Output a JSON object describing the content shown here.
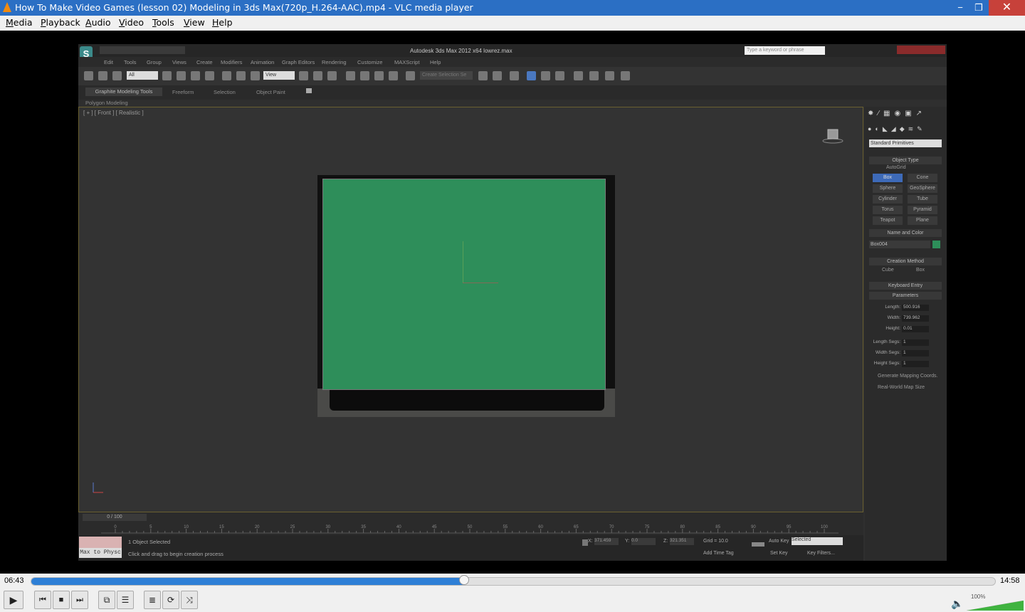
{
  "window": {
    "title": "How To Make Video Games (lesson 02) Modeling in 3ds Max(720p_H.264-AAC).mp4 - VLC media player",
    "min": "−",
    "max": "❐",
    "close": "✕"
  },
  "menubar": {
    "items": [
      {
        "u": "M",
        "rest": "edia"
      },
      {
        "u": "P",
        "rest": "layback"
      },
      {
        "u": "A",
        "rest": "udio"
      },
      {
        "u": "V",
        "rest": "ideo"
      },
      {
        "u": "T",
        "rest": "ools"
      },
      {
        "u": "V",
        "rest": "iew"
      },
      {
        "u": "H",
        "rest": "elp"
      }
    ]
  },
  "max": {
    "title": "Autodesk 3ds Max 2012 x64     lowrez.max",
    "search_placeholder": "Type a keyword or phrase",
    "logo": "S",
    "menu": [
      "Edit",
      "Tools",
      "Group",
      "Views",
      "Create",
      "Modifiers",
      "Animation",
      "Graph Editors",
      "Rendering",
      "Customize",
      "MAXScript",
      "Help"
    ],
    "toolbar": {
      "selection_filter": "All",
      "ref_coord": "View",
      "named_sel": "Create Selection Se"
    },
    "ribbon_tabs": [
      "Graphite Modeling Tools",
      "Freeform",
      "Selection",
      "Object Paint"
    ],
    "ribbon_sub": "Polygon Modeling",
    "viewport_label": "[ + ] [ Front ] [ Realistic ]",
    "time_slider": "0 / 100",
    "ruler_ticks": [
      "0",
      "5",
      "10",
      "15",
      "20",
      "25",
      "30",
      "35",
      "40",
      "45",
      "50",
      "55",
      "60",
      "65",
      "70",
      "75",
      "80",
      "85",
      "90",
      "95",
      "100"
    ],
    "status": {
      "macro": "Max to Physc",
      "selected": "1 Object Selected",
      "prompt": "Click and drag to begin creation process",
      "x_label": "X:",
      "x_val": "371.459",
      "y_label": "Y:",
      "y_val": "0.0",
      "z_label": "Z:",
      "z_val": "321.351",
      "grid": "Grid = 10.0",
      "auto_key": "Auto Key",
      "key_mode": "Selected",
      "set_key": "Set Key",
      "key_filters": "Key Filters...",
      "add_time_tag": "Add Time Tag",
      "frame": "0"
    },
    "panel": {
      "dropdown": "Standard Primitives",
      "object_type_title": "Object Type",
      "autogrid": "AutoGrid",
      "objects": [
        "Box",
        "Cone",
        "Sphere",
        "GeoSphere",
        "Cylinder",
        "Tube",
        "Torus",
        "Pyramid",
        "Teapot",
        "Plane"
      ],
      "name_color_title": "Name and Color",
      "name_value": "Box004",
      "creation_title": "Creation Method",
      "creation_cube": "Cube",
      "creation_box": "Box",
      "keyboard_title": "Keyboard Entry",
      "params_title": "Parameters",
      "params": [
        {
          "label": "Length:",
          "value": "500.916"
        },
        {
          "label": "Width:",
          "value": "739.962"
        },
        {
          "label": "Height:",
          "value": "0.01"
        },
        {
          "label": "Length Segs:",
          "value": "1"
        },
        {
          "label": "Width Segs:",
          "value": "1"
        },
        {
          "label": "Height Segs:",
          "value": "1"
        }
      ],
      "gen_mapping": "Generate Mapping Coords.",
      "real_world": "Real-World Map Size"
    }
  },
  "player": {
    "time_elapsed": "06:43",
    "time_total": "14:58",
    "progress": 0.449,
    "volume_label": "100%",
    "volume": 1.0
  },
  "colors": {
    "titlebar": "#2b6fc4",
    "accent": "#2e7fd6",
    "close": "#c7413a",
    "plane": "#2e8e5a"
  }
}
